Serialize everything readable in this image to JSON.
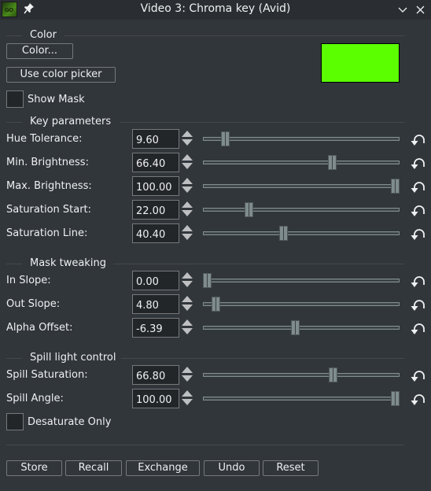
{
  "window": {
    "title": "Video 3: Chroma key (Avid)",
    "app_icon": "app-logo-icon",
    "pin_icon": "pin-icon",
    "minimize_icon": "chevron-down-icon",
    "close_icon": "close-icon"
  },
  "color_group": {
    "title": "Color",
    "color_button": "Color...",
    "picker_button": "Use color picker",
    "swatch_color": "#5bff00",
    "show_mask": {
      "label": "Show Mask",
      "checked": false
    }
  },
  "key_parameters": {
    "title": "Key parameters",
    "rows": [
      {
        "label": "Hue Tolerance:",
        "value": "9.60",
        "fraction": 0.096
      },
      {
        "label": "Min. Brightness:",
        "value": "66.40",
        "fraction": 0.664
      },
      {
        "label": "Max. Brightness:",
        "value": "100.00",
        "fraction": 1.0
      },
      {
        "label": "Saturation Start:",
        "value": "22.00",
        "fraction": 0.22
      },
      {
        "label": "Saturation Line:",
        "value": "40.40",
        "fraction": 0.404
      }
    ]
  },
  "mask_tweaking": {
    "title": "Mask tweaking",
    "rows": [
      {
        "label": "In Slope:",
        "value": "0.00",
        "fraction": 0.0
      },
      {
        "label": "Out Slope:",
        "value": "4.80",
        "fraction": 0.048
      },
      {
        "label": "Alpha Offset:",
        "value": "-6.39",
        "fraction": 0.468
      }
    ]
  },
  "spill_light_control": {
    "title": "Spill light control",
    "rows": [
      {
        "label": "Spill Saturation:",
        "value": "66.80",
        "fraction": 0.668
      },
      {
        "label": "Spill Angle:",
        "value": "100.00",
        "fraction": 1.0
      }
    ],
    "desaturate_only": {
      "label": "Desaturate Only",
      "checked": false
    }
  },
  "footer": {
    "buttons": [
      "Store",
      "Recall",
      "Exchange",
      "Undo",
      "Reset"
    ]
  },
  "colors": {
    "background": "#31363b",
    "titlebar": "#2a2e32",
    "text": "#eff0f1",
    "border": "#76797c",
    "input_bg": "#232629"
  }
}
